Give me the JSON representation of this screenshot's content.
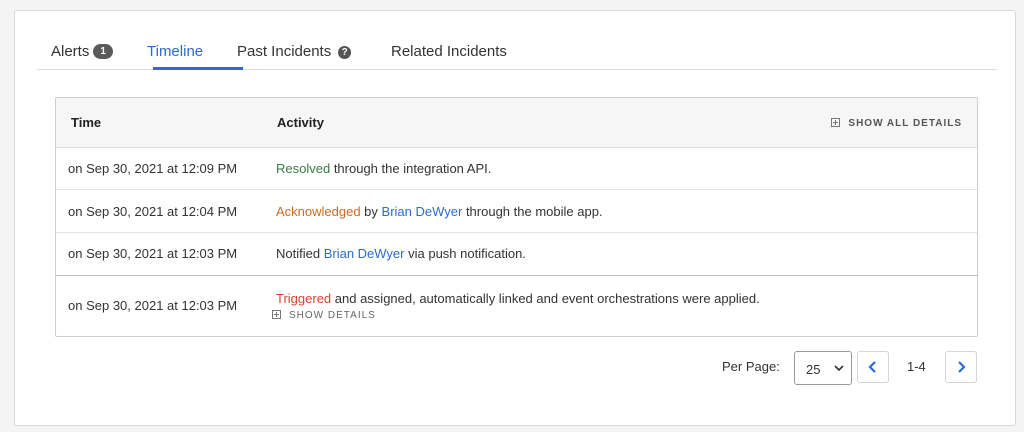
{
  "tabs": [
    {
      "label": "Alerts",
      "badge": "1"
    },
    {
      "label": "Timeline"
    },
    {
      "label": "Past Incidents"
    },
    {
      "label": "Related Incidents"
    }
  ],
  "table": {
    "headers": {
      "time": "Time",
      "activity": "Activity"
    },
    "show_all_details": "SHOW ALL DETAILS",
    "rows": [
      {
        "time": "on Sep 30, 2021 at 12:09 PM",
        "status": "Resolved",
        "rest": " through the integration API."
      },
      {
        "time": "on Sep 30, 2021 at 12:04 PM",
        "status": "Acknowledged",
        "by": " by ",
        "user": "Brian DeWyer",
        "rest": " through the mobile app."
      },
      {
        "time": "on Sep 30, 2021 at 12:03 PM",
        "prefix": "Notified ",
        "user": "Brian DeWyer",
        "rest": " via push notification."
      },
      {
        "time": "on Sep 30, 2021 at 12:03 PM",
        "status": "Triggered",
        "rest": " and assigned, automatically linked and event orchestrations were applied.",
        "details": "SHOW DETAILS"
      }
    ]
  },
  "pagination": {
    "per_page_label": "Per Page:",
    "per_page_value": "25",
    "range": "1-4"
  },
  "colors": {
    "accent": "#2d6bd3",
    "resolved": "#3a7d44",
    "acknowledged": "#d2691e",
    "triggered": "#d64532"
  }
}
